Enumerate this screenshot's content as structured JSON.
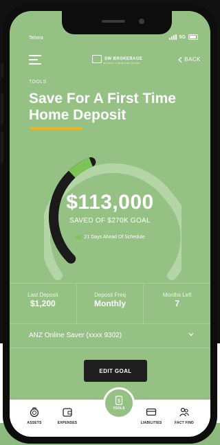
{
  "status_bar": {
    "carrier": "Telstra",
    "network": "5G"
  },
  "header": {
    "brand_name": "SW BROKERAGE",
    "brand_tagline": "BUILDING A BRIGHTER FUTURE",
    "back_label": "BACK"
  },
  "page": {
    "eyebrow": "TOOLS",
    "title": "Save For A First Time Home Deposit"
  },
  "goal": {
    "amount": "$113,000",
    "saved_label": "SAVED OF $270K GOAL",
    "schedule_text": "21 Days Ahead Of Schedule",
    "progress_fraction": 0.42
  },
  "stats": [
    {
      "label": "Last Deposit",
      "value": "$1,200"
    },
    {
      "label": "Deposit Freq",
      "value": "Monthly"
    },
    {
      "label": "Months Left",
      "value": "7"
    }
  ],
  "account": {
    "selected": "ANZ Online Saver (xxxx 9302)"
  },
  "actions": {
    "edit_goal": "EDIT GOAL"
  },
  "tabbar": {
    "tools_label": "TOOLS",
    "items": [
      {
        "label": "ASSETS",
        "icon": "coins-icon"
      },
      {
        "label": "EXPENSES",
        "icon": "wallet-icon"
      },
      {
        "label": "LIABILITIES",
        "icon": "card-icon"
      },
      {
        "label": "FACT FIND",
        "icon": "people-icon"
      }
    ]
  },
  "colors": {
    "screen_bg": "#95c184",
    "accent_underline": "#f2b21b",
    "gauge_track": "#1a1a1a",
    "gauge_highlight": "#7cc456",
    "button_dark": "#1f1f1f"
  }
}
